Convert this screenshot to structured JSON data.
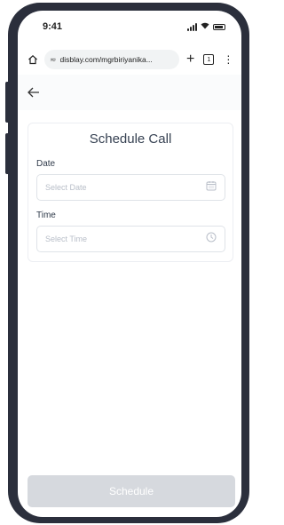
{
  "status_bar": {
    "time": "9:41"
  },
  "browser": {
    "url": "disblay.com/mgrbiriyanika..."
  },
  "page": {
    "title": "Schedule Call",
    "date": {
      "label": "Date",
      "placeholder": "Select Date"
    },
    "time": {
      "label": "Time",
      "placeholder": "Select Time"
    },
    "submit_label": "Schedule"
  },
  "colors": {
    "frame": "#2b2f3c",
    "button_disabled": "#d6d9de",
    "title_text": "#364152",
    "placeholder": "#b8bec8"
  },
  "icons": [
    "signal-icon",
    "wifi-icon",
    "battery-icon",
    "home-icon",
    "site-settings-icon",
    "plus-icon",
    "tabs-icon",
    "menu-icon",
    "back-arrow-icon",
    "calendar-icon",
    "clock-icon"
  ]
}
